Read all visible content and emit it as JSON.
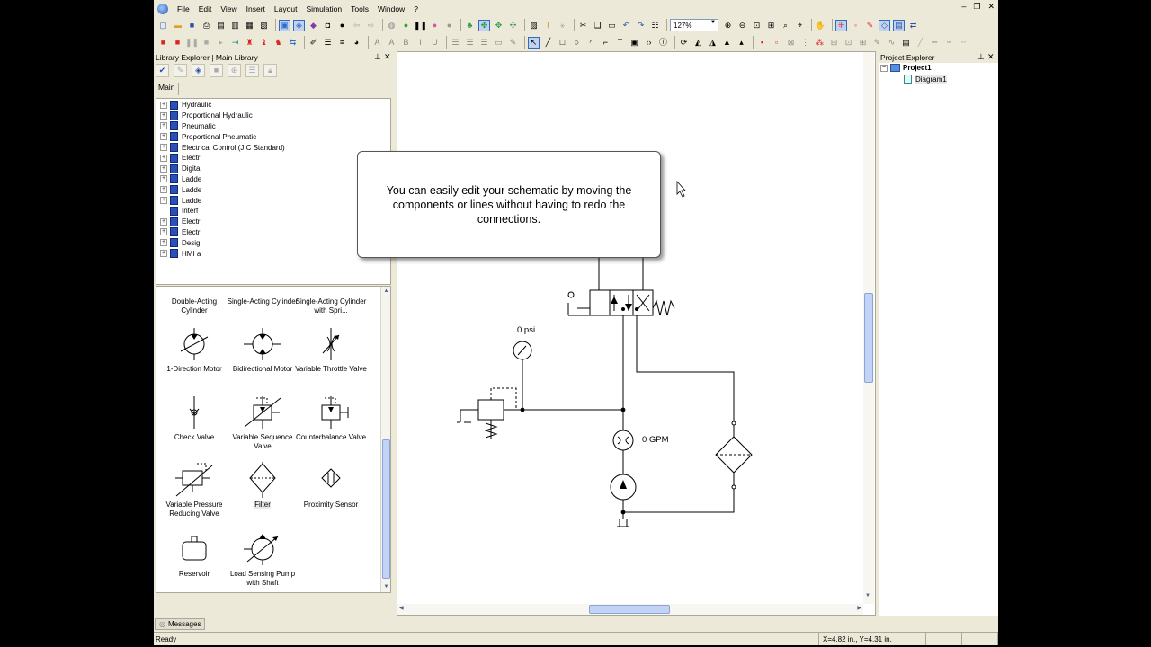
{
  "menu": [
    "File",
    "Edit",
    "View",
    "Insert",
    "Layout",
    "Simulation",
    "Tools",
    "Window",
    "?"
  ],
  "toolbar": {
    "zoom_value": "127%"
  },
  "library": {
    "title": "Library Explorer | Main Library",
    "tab": "Main",
    "tree_items": [
      "Hydraulic",
      "Proportional Hydraulic",
      "Pneumatic",
      "Proportional Pneumatic",
      "Electrical Control (JIC Standard)",
      "Electr",
      "Digita",
      "Ladde",
      "Ladde",
      "Ladde",
      "Interf",
      "Electr",
      "Electr",
      "Desig",
      "HMI a"
    ],
    "components": [
      {
        "label": "Double-Acting Cylinder",
        "icon": "double-acting-cylinder-icon"
      },
      {
        "label": "Single-Acting Cylinder",
        "icon": "single-acting-cylinder-icon"
      },
      {
        "label": "Single-Acting Cylinder with Spri...",
        "icon": "single-acting-spring-cylinder-icon"
      },
      {
        "label": "1-Direction Motor",
        "icon": "one-direction-motor-icon"
      },
      {
        "label": "Bidirectional Motor",
        "icon": "bidirectional-motor-icon"
      },
      {
        "label": "Variable Throttle Valve",
        "icon": "variable-throttle-valve-icon"
      },
      {
        "label": "Check Valve",
        "icon": "check-valve-icon"
      },
      {
        "label": "Variable Sequence Valve",
        "icon": "variable-sequence-valve-icon"
      },
      {
        "label": "Counterbalance Valve",
        "icon": "counterbalance-valve-icon"
      },
      {
        "label": "Variable Pressure Reducing Valve",
        "icon": "variable-pressure-reducing-valve-icon"
      },
      {
        "label": "Filter",
        "icon": "filter-icon"
      },
      {
        "label": "Proximity Sensor",
        "icon": "proximity-sensor-icon"
      },
      {
        "label": "Reservoir",
        "icon": "reservoir-icon"
      },
      {
        "label": "Load Sensing Pump with Shaft",
        "icon": "load-sensing-pump-icon"
      }
    ]
  },
  "diagram": {
    "pressure_label": "0 psi",
    "flow_label": "0 GPM"
  },
  "project": {
    "title": "Project Explorer",
    "root": "Project1",
    "child": "Diagram1"
  },
  "callout": {
    "text": "You can easily edit your schematic by moving the components or lines without having to redo the connections."
  },
  "messages_tab": "Messages",
  "status": {
    "ready": "Ready",
    "coords": "X=4.82 in., Y=4.31 in."
  }
}
